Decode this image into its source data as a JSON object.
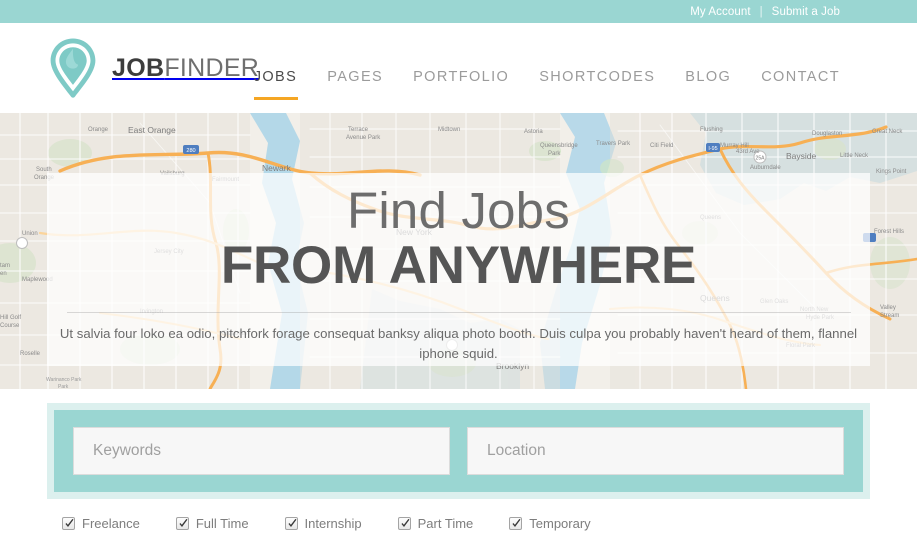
{
  "topbar": {
    "my_account": "My Account",
    "separator": "|",
    "submit_job": "Submit a Job"
  },
  "brand": {
    "part1": "JOB",
    "part2": "FINDER",
    "logo_icon": "map-pin-icon"
  },
  "nav": {
    "items": [
      {
        "label": "JOBS",
        "active": true
      },
      {
        "label": "PAGES",
        "active": false
      },
      {
        "label": "PORTFOLIO",
        "active": false
      },
      {
        "label": "SHORTCODES",
        "active": false
      },
      {
        "label": "BLOG",
        "active": false
      },
      {
        "label": "CONTACT",
        "active": false
      }
    ]
  },
  "hero": {
    "title_thin": "Find Jobs",
    "title_bold": "FROM ANYWHERE",
    "paragraph": "Ut salvia four loko ea odio, pitchfork forage consequat banksy aliqua photo booth. Duis culpa you probably haven't heard of them, flannel iphone squid.",
    "map_labels": [
      "Orange",
      "East Orange",
      "South Orange",
      "Maplewood",
      "Vailsburg",
      "Fairmount",
      "Newark",
      "Irvington",
      "Elizabeth",
      "Roselle",
      "Warinanco Park",
      "Jersey City",
      "New York",
      "Brooklyn",
      "Astoria",
      "Queensbridge",
      "Travers Park",
      "Citi Field",
      "Queens",
      "Murray Hill",
      "Bayside",
      "Douglaston",
      "Little Neck",
      "Auburndale",
      "Glen Oaks",
      "North New Hyde Park",
      "Floral Park",
      "Flushing",
      "Terrace Avenue Park",
      "Midtown",
      "Union",
      "Hill Golf Course",
      "43rd Ave",
      "Vally Stream",
      "Forest Hills"
    ]
  },
  "search": {
    "keywords_placeholder": "Keywords",
    "keywords_value": "",
    "location_placeholder": "Location",
    "location_value": ""
  },
  "filters": [
    {
      "label": "Freelance",
      "checked": true
    },
    {
      "label": "Full Time",
      "checked": true
    },
    {
      "label": "Internship",
      "checked": true
    },
    {
      "label": "Part Time",
      "checked": true
    },
    {
      "label": "Temporary",
      "checked": true
    }
  ],
  "colors": {
    "teal": "#9ad6d2",
    "teal_light": "#dcf0ee",
    "accent_orange": "#f5a623",
    "text_dark": "#4a4a4a",
    "text_muted": "#9b9b9b"
  }
}
